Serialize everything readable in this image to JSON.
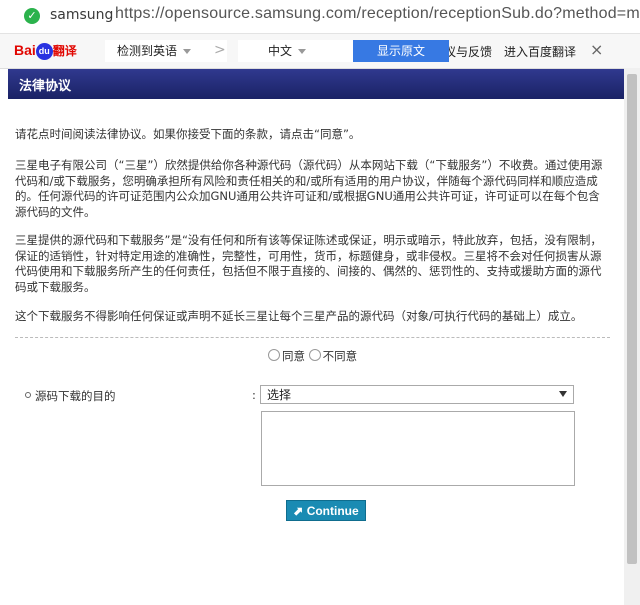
{
  "browser": {
    "site_name": "samsung",
    "url": "https://opensource.samsung.com/reception/receptionSub.do?method=mo"
  },
  "translate_bar": {
    "logo_text_a": "Bai",
    "logo_text_b": "du",
    "logo_text_c": "翻译",
    "from_lang": "检测到英语",
    "arrow": ">",
    "to_lang": "中文",
    "show_original": "显示原文",
    "feedback": "议与反馈",
    "enter_baidu": "进入百度翻译",
    "close": "×"
  },
  "page": {
    "header": "法律协议",
    "para1": "请花点时间阅读法律协议。如果你接受下面的条款，请点击“同意”。",
    "para2": "三星电子有限公司（“三星”）欣然提供给你各种源代码（源代码）从本网站下载（“下载服务”）不收费。通过使用源代码和/或下载服务，您明确承担所有风险和责任相关的和/或所有适用的用户协议，伴随每个源代码同样和顺应造成的。任何源代码的许可证范围内公众加GNU通用公共许可证和/或根据GNU通用公共许可证，许可证可以在每个包含源代码的文件。",
    "para3": "三星提供的源代码和下载服务”是“没有任何和所有该等保证陈述或保证，明示或暗示，特此放弃，包括，没有限制，保证的适销性，针对特定用途的准确性，完整性，可用性，货币，标题健身，或非侵权。三星将不会对任何损害从源代码使用和下载服务所产生的任何责任，包括但不限于直接的、间接的、偶然的、惩罚性的、支持或援助方面的源代码或下载服务。",
    "para4": "这个下载服务不得影响任何保证或声明不延长三星让每个三星产品的源代码（对象/可执行代码的基础上）成立。",
    "agree": "同意",
    "disagree": "不同意",
    "purpose_label": "源码下载的目的",
    "colon": ":",
    "select_value": "选择",
    "continue": "Continue"
  }
}
